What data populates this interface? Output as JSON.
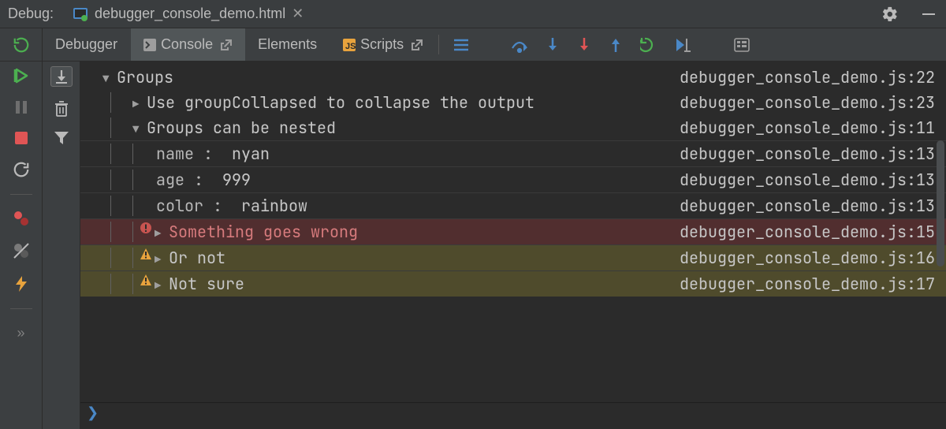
{
  "titlebar": {
    "label": "Debug:",
    "file": "debugger_console_demo.html"
  },
  "tabs": {
    "debugger": "Debugger",
    "console": "Console",
    "elements": "Elements",
    "scripts": "Scripts"
  },
  "console": {
    "root": {
      "label": "Groups",
      "loc": "debugger_console_demo.js:22"
    },
    "collapsed_example": {
      "label": "Use groupCollapsed to collapse the output",
      "loc": "debugger_console_demo.js:23"
    },
    "nested": {
      "label": "Groups can be nested",
      "loc": "debugger_console_demo.js:11"
    },
    "kv": [
      {
        "key": "name",
        "val": "nyan",
        "loc": "debugger_console_demo.js:13"
      },
      {
        "key": "age",
        "val": "999",
        "loc": "debugger_console_demo.js:13"
      },
      {
        "key": "color",
        "val": "rainbow",
        "loc": "debugger_console_demo.js:13"
      }
    ],
    "error": {
      "label": "Something goes wrong",
      "loc": "debugger_console_demo.js:15"
    },
    "warnings": [
      {
        "label": "Or not",
        "loc": "debugger_console_demo.js:16"
      },
      {
        "label": "Not sure",
        "loc": "debugger_console_demo.js:17"
      }
    ]
  }
}
